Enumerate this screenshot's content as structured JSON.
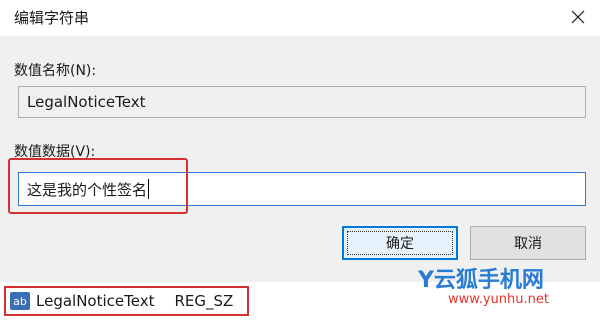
{
  "dialog": {
    "title": "编辑字符串",
    "name_label": "数值名称(N):",
    "name_value": "LegalNoticeText",
    "data_label": "数值数据(V):",
    "data_value": "这是我的个性签名",
    "ok_label": "确定",
    "cancel_label": "取消"
  },
  "registry_entry": {
    "icon_text": "ab",
    "name": "LegalNoticeText",
    "type": "REG_SZ"
  },
  "watermark": {
    "brand": "Y云狐手机网",
    "url": "www.yunhu.net"
  },
  "colors": {
    "highlight": "#d63131",
    "focus": "#0078d7",
    "brand": "#2a7bd3"
  }
}
